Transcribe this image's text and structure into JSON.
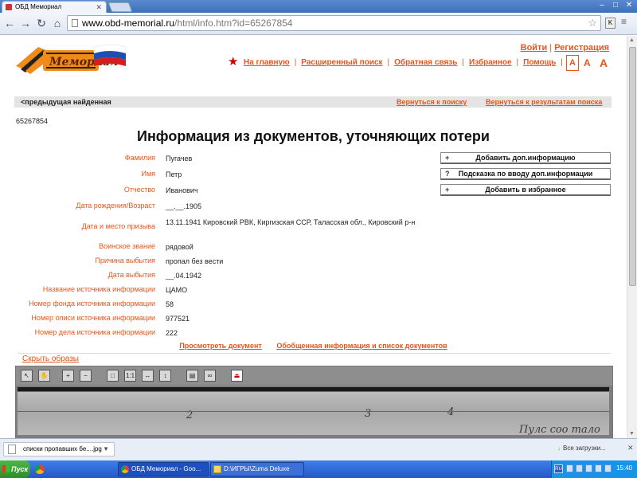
{
  "browser": {
    "tab_title": "ОБД Мемориал",
    "url_host": "www.obd-memorial.ru",
    "url_path": "/html/info.htm?id=65267854"
  },
  "site": {
    "login": "Войти",
    "auth_sep": "|",
    "register": "Регистрация",
    "nav": [
      "На главную",
      "Расширенный поиск",
      "Обратная связь",
      "Избранное",
      "Помощь"
    ],
    "font_sizes": [
      "A",
      "A",
      "A"
    ],
    "logo_colors": {
      "ribbon_black": "#222222",
      "ribbon_orange": "#f08a18",
      "flag_white": "#ffffff",
      "flag_blue": "#1c4fb0",
      "flag_red": "#d41d1d"
    }
  },
  "findbar": {
    "prev": "<предыдущая найденная",
    "back_search": "Вернуться к поиску",
    "back_results": "Вернуться к результатам поиска"
  },
  "record": {
    "id": "65267854",
    "title": "Информация из документов, уточняющих потери",
    "fields": [
      {
        "label": "Фамилия",
        "value": "Пугачев"
      },
      {
        "label": "Имя",
        "value": "Петр"
      },
      {
        "label": "Отчество",
        "value": "Иванович"
      },
      {
        "label": "Дата рождения/Возраст",
        "value": "__.__.1905"
      },
      {
        "label": "Дата и место призыва",
        "value": "13.11.1941 Кировский РВК, Киргизская ССР, Таласская обл., Кировский р-н"
      },
      {
        "label": "Воинское звание",
        "value": "рядовой"
      },
      {
        "label": "Причина выбытия",
        "value": "пропал без вести"
      },
      {
        "label": "Дата выбытия",
        "value": "__.04.1942"
      },
      {
        "label": "Название источника информации",
        "value": "ЦАМО"
      },
      {
        "label": "Номер фонда источника информации",
        "value": "58"
      },
      {
        "label": "Номер описи источника информации",
        "value": "977521"
      },
      {
        "label": "Номер дела источника информации",
        "value": "222"
      }
    ],
    "actions": [
      {
        "icon": "+",
        "label": "Добавить доп.информацию"
      },
      {
        "icon": "?",
        "label": "Подсказка по вводу доп.информации"
      },
      {
        "icon": "+",
        "label": "Добавить в избранное"
      }
    ],
    "view_document": "Просмотреть документ",
    "summary": "Обобщенная информация и список документов",
    "hide_images": "Скрыть образы"
  },
  "viewer": {
    "tools": [
      "pointer-icon",
      "hand-icon",
      "zoom-in-icon",
      "zoom-out-icon",
      "fit-page-icon",
      "actual-size-icon",
      "fit-width-icon",
      "fit-height-icon",
      "print-icon",
      "link-icon",
      "pdf-icon"
    ],
    "scan_marks": [
      "2",
      "3",
      "4",
      "Пулс соо тало"
    ]
  },
  "downloads": {
    "file": "списки пропавших бе....jpg",
    "all": "Все загрузки..."
  },
  "taskbar": {
    "start": "Пуск",
    "tasks": [
      "ОБД Мемориал - Goo...",
      "D:\\ИГРЫ\\Zuma Deluxe"
    ],
    "lang": "RU",
    "clock": "15:40"
  }
}
